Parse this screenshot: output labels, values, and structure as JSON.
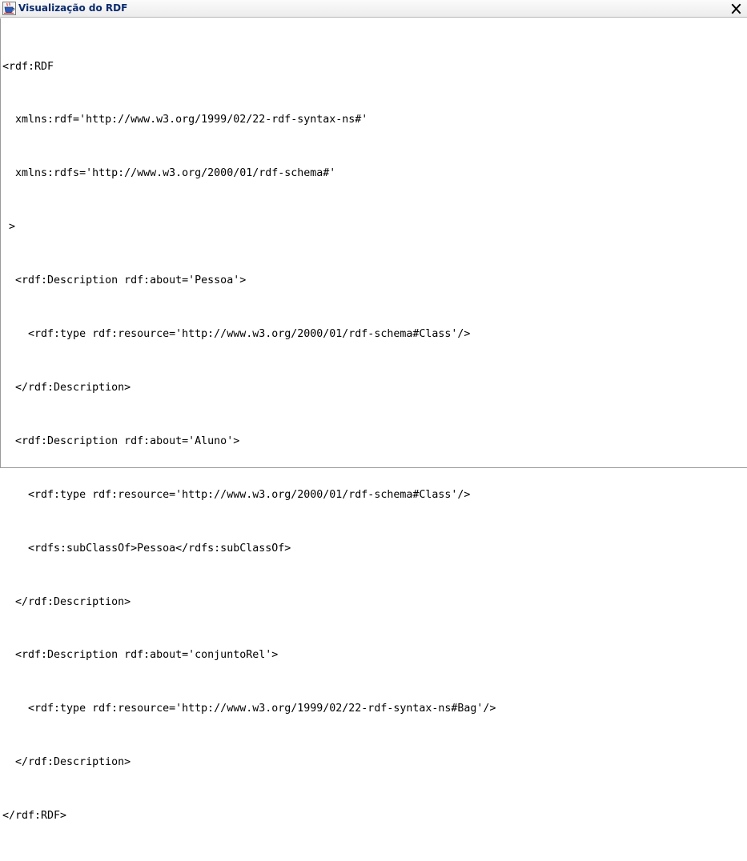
{
  "window": {
    "title": "Visualização do RDF",
    "icon": "java-coffee-cup-icon",
    "close_glyph": "close-x-icon"
  },
  "rdf_view": {
    "lines": [
      "<rdf:RDF",
      "  xmlns:rdf='http://www.w3.org/1999/02/22-rdf-syntax-ns#'",
      "  xmlns:rdfs='http://www.w3.org/2000/01/rdf-schema#'",
      " >",
      "  <rdf:Description rdf:about='Pessoa'>",
      "    <rdf:type rdf:resource='http://www.w3.org/2000/01/rdf-schema#Class'/>",
      "  </rdf:Description>",
      "  <rdf:Description rdf:about='Aluno'>",
      "    <rdf:type rdf:resource='http://www.w3.org/2000/01/rdf-schema#Class'/>",
      "    <rdfs:subClassOf>Pessoa</rdfs:subClassOf>",
      "  </rdf:Description>",
      "  <rdf:Description rdf:about='conjuntoRel'>",
      "    <rdf:type rdf:resource='http://www.w3.org/1999/02/22-rdf-syntax-ns#Bag'/>",
      "  </rdf:Description>",
      "</rdf:RDF>"
    ]
  },
  "colors": {
    "title_text": "#0a2a6e",
    "text": "#000000",
    "background": "#ffffff"
  }
}
